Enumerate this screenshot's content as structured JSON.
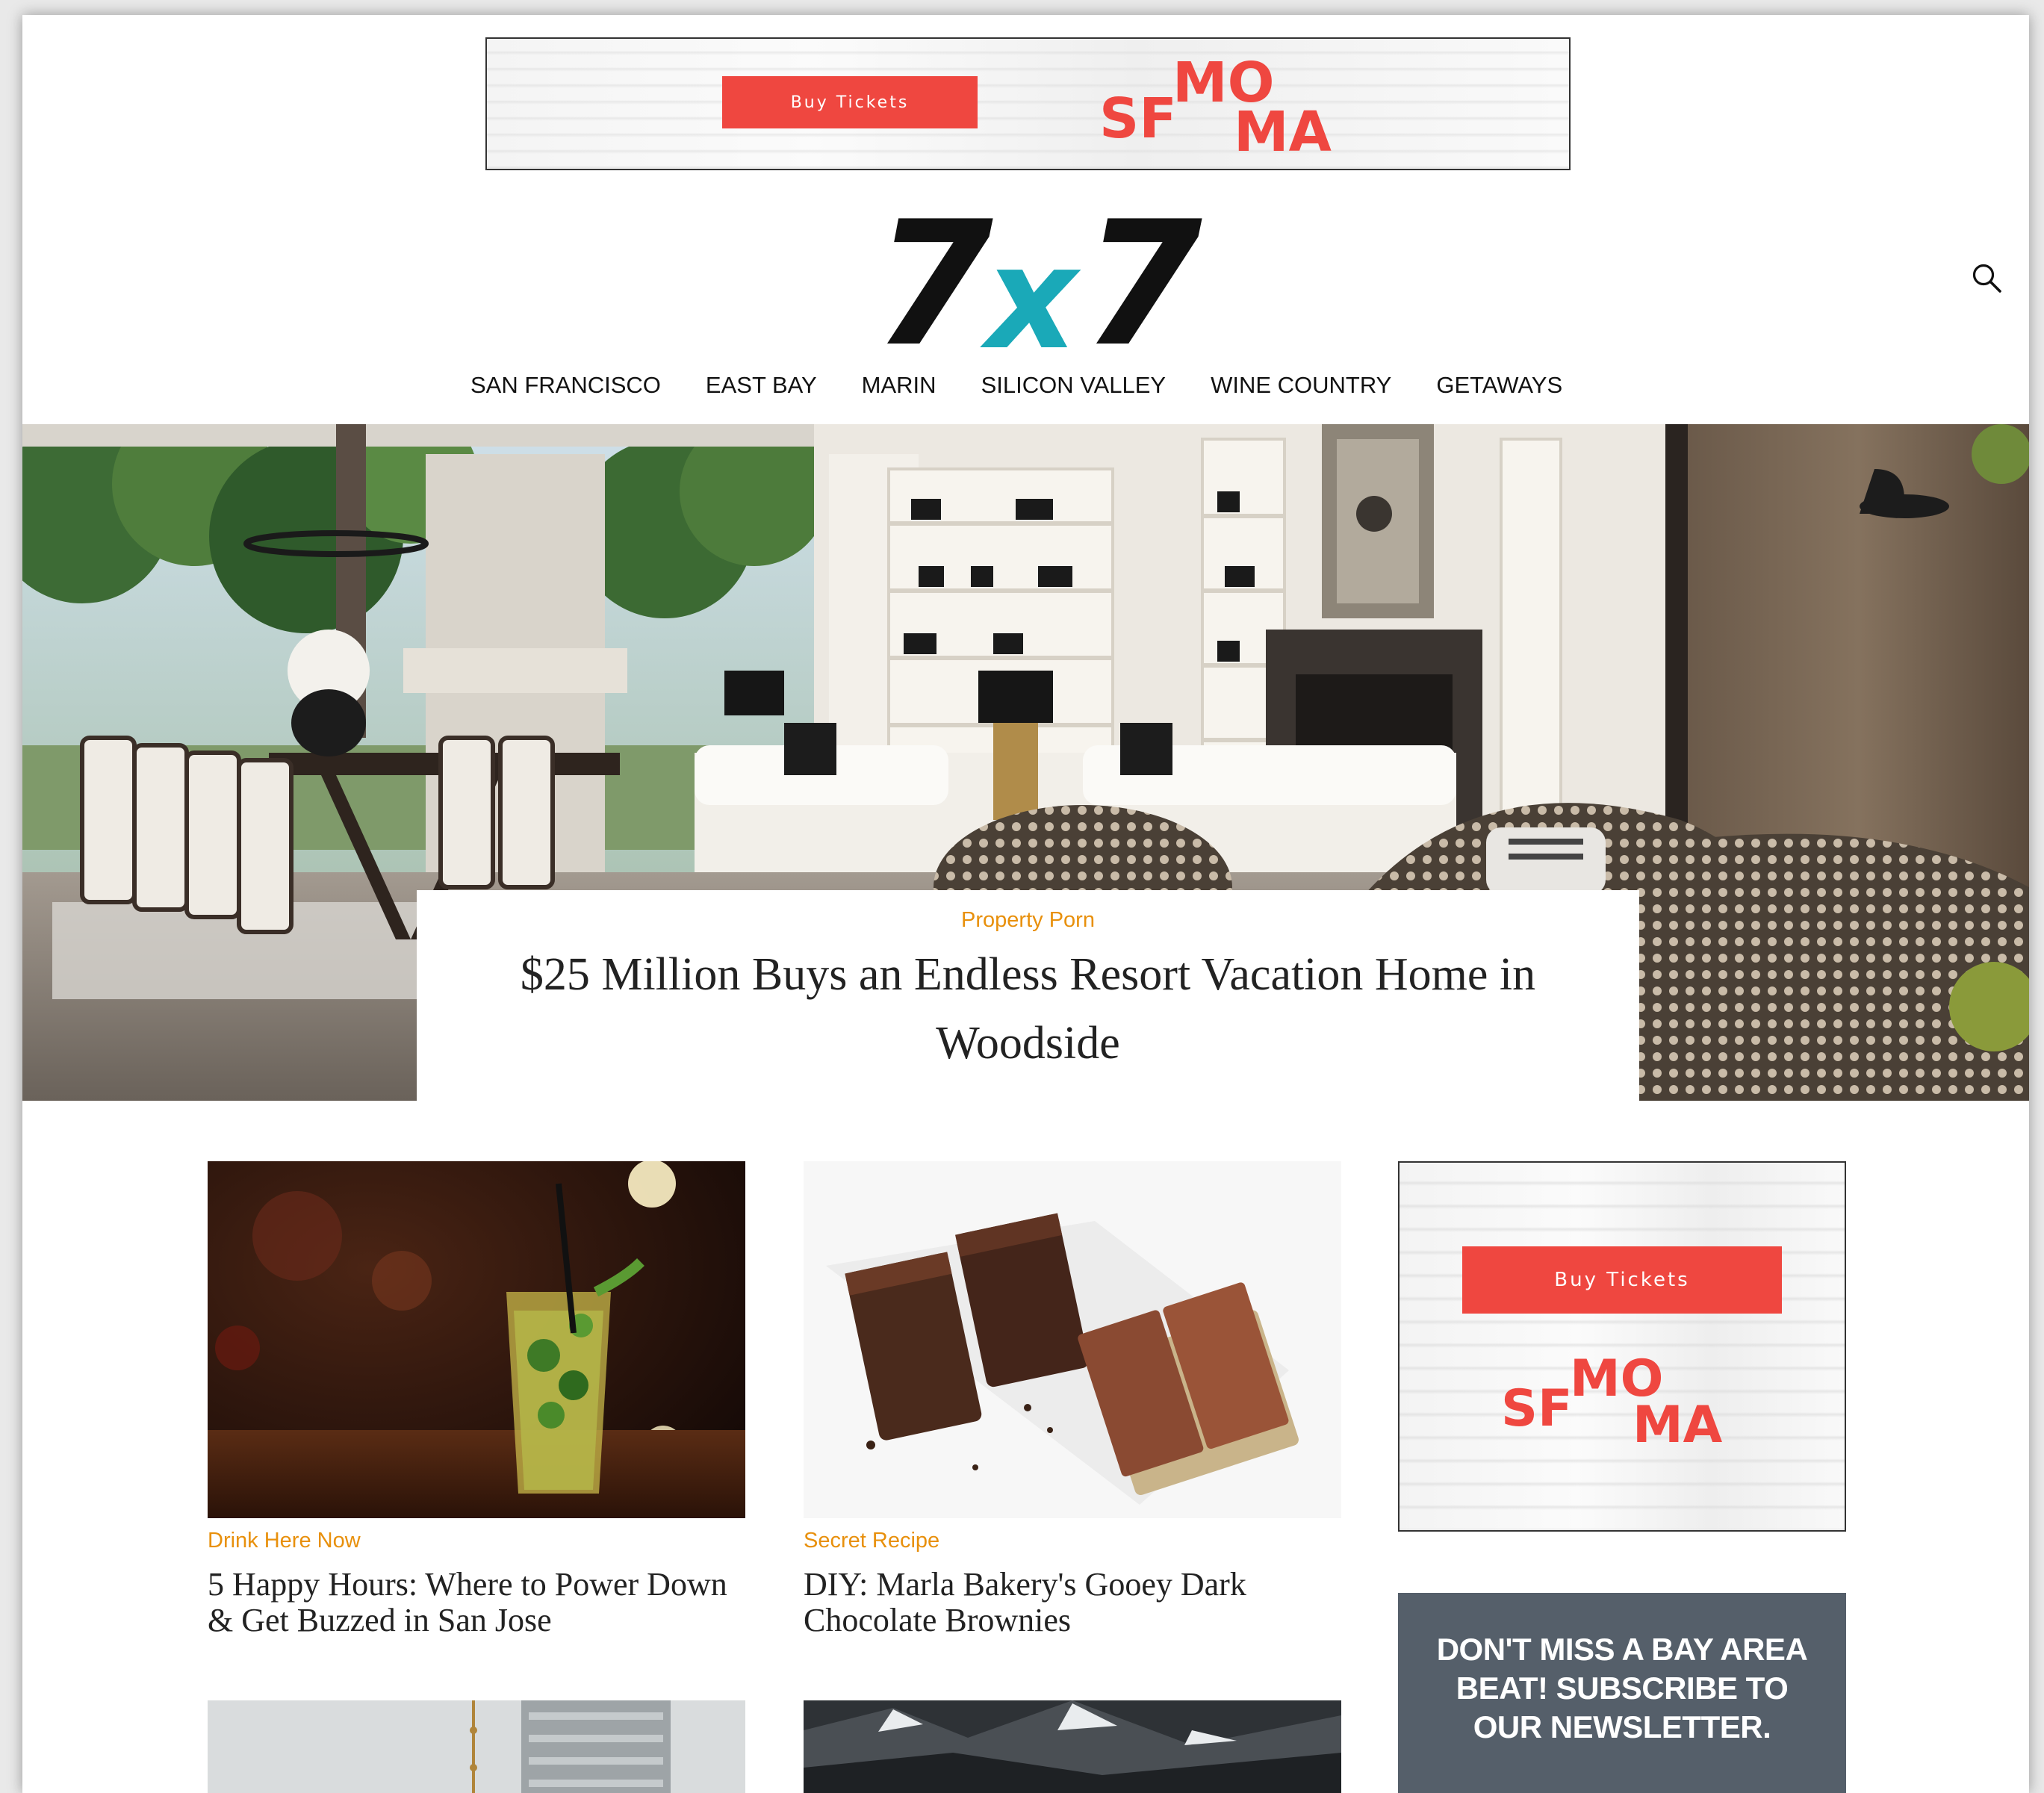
{
  "top_ad": {
    "button_label": "Buy Tickets",
    "brand_sf": "SF",
    "brand_mo": "MO",
    "brand_ma": "MA",
    "brand_color": "#ef4740"
  },
  "header": {
    "logo_left": "7",
    "logo_x": "x",
    "logo_right": "7",
    "logo_accent": "#1aa9b8",
    "search_icon": "search-icon"
  },
  "nav": {
    "items": [
      {
        "label": "SAN FRANCISCO"
      },
      {
        "label": "EAST BAY"
      },
      {
        "label": "MARIN"
      },
      {
        "label": "SILICON VALLEY"
      },
      {
        "label": "WINE COUNTRY"
      },
      {
        "label": "GETAWAYS"
      }
    ]
  },
  "hero": {
    "kicker": "Property Porn",
    "title": "$25 Million Buys an Endless Resort Vacation Home in Woodside"
  },
  "articles": [
    {
      "kicker": "Drink Here Now",
      "title": "5 Happy Hours: Where to Power Down & Get Buzzed in San Jose"
    },
    {
      "kicker": "Secret Recipe",
      "title": "DIY: Marla Bakery's Gooey Dark Chocolate Brownies"
    }
  ],
  "side_ad": {
    "button_label": "Buy Tickets",
    "brand_sf": "SF",
    "brand_mo": "MO",
    "brand_ma": "MA"
  },
  "newsletter": {
    "text": "DON'T MISS A BAY AREA BEAT! SUBSCRIBE TO OUR NEWSLETTER."
  },
  "colors": {
    "kicker": "#e8900c",
    "newsletter_bg": "#555f6a"
  }
}
